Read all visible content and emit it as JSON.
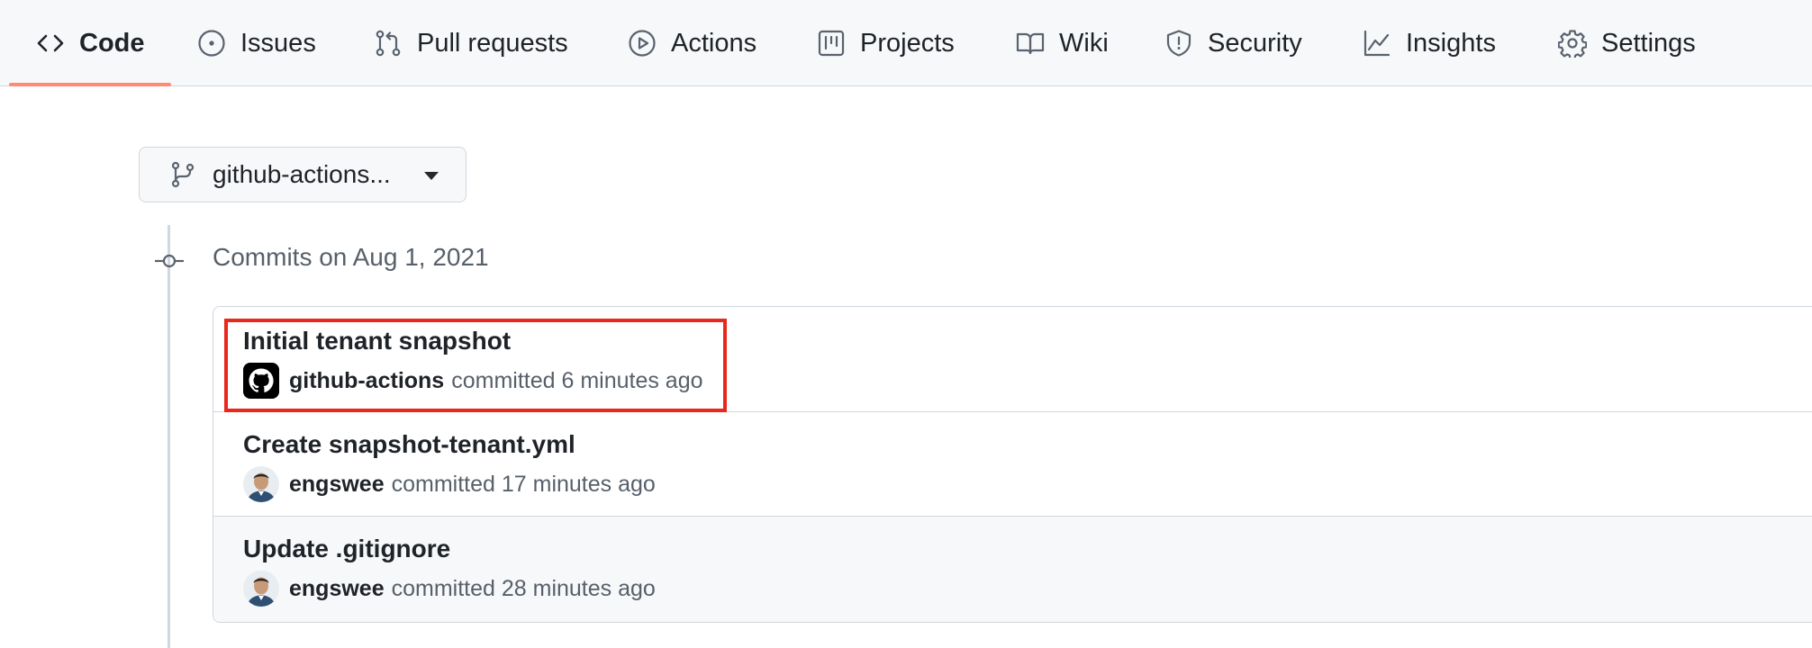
{
  "tabs": [
    {
      "label": "Code",
      "icon": "code-icon",
      "selected": true
    },
    {
      "label": "Issues",
      "icon": "issue-opened-icon",
      "selected": false
    },
    {
      "label": "Pull requests",
      "icon": "git-pull-request-icon",
      "selected": false
    },
    {
      "label": "Actions",
      "icon": "play-icon",
      "selected": false
    },
    {
      "label": "Projects",
      "icon": "project-icon",
      "selected": false
    },
    {
      "label": "Wiki",
      "icon": "book-icon",
      "selected": false
    },
    {
      "label": "Security",
      "icon": "shield-icon",
      "selected": false
    },
    {
      "label": "Insights",
      "icon": "graph-icon",
      "selected": false
    },
    {
      "label": "Settings",
      "icon": "gear-icon",
      "selected": false
    }
  ],
  "branch": {
    "name": "github-actions...",
    "icon": "git-branch-icon"
  },
  "commit_group": {
    "date_heading": "Commits on Aug 1, 2021"
  },
  "commits": [
    {
      "title": "Initial tenant snapshot",
      "author": "github-actions",
      "meta": "committed 6 minutes ago",
      "avatar": "github-mark",
      "highlighted": true
    },
    {
      "title": "Create snapshot-tenant.yml",
      "author": "engswee",
      "meta": "committed 17 minutes ago",
      "avatar": "user-photo"
    },
    {
      "title": "Update .gitignore",
      "author": "engswee",
      "meta": "committed 28 minutes ago",
      "avatar": "user-photo"
    }
  ],
  "colors": {
    "tab_underline": "#fd8c73",
    "highlight_border": "#e8271d",
    "nav_background": "#f6f8fa",
    "border": "#d0d7de",
    "muted_text": "#57606a"
  }
}
